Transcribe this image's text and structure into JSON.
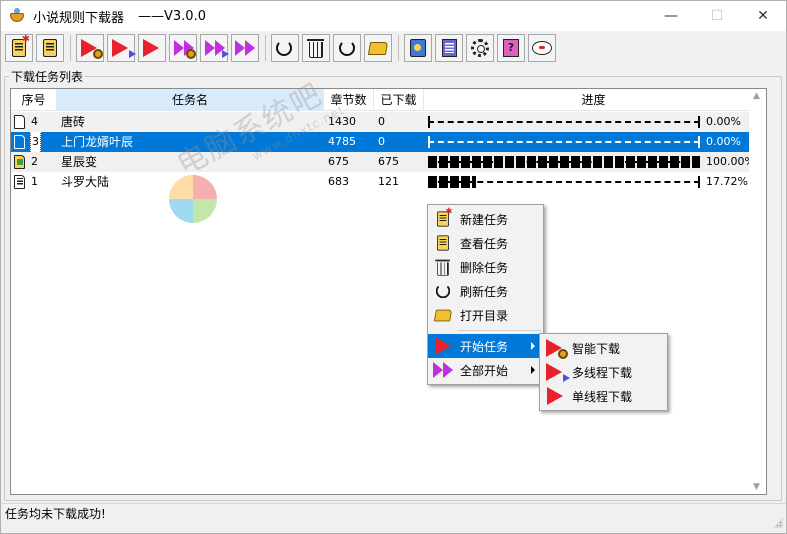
{
  "window": {
    "title": "小说规则下载器",
    "version": "——V3.0.0",
    "icon": "bowl-icon",
    "controls": {
      "minimize": "—",
      "maximize": "☐",
      "close": "✕"
    }
  },
  "toolbar": {
    "buttons": [
      {
        "name": "new-task",
        "icon": "new-document-icon"
      },
      {
        "name": "view-task",
        "icon": "document-lines-icon"
      },
      {
        "name": "smart-download",
        "icon": "play-gear-icon"
      },
      {
        "name": "multi-thread-download",
        "icon": "play-multi-icon"
      },
      {
        "name": "single-thread-download",
        "icon": "play-icon"
      },
      {
        "name": "start-all-smart",
        "icon": "fast-forward-gear-icon"
      },
      {
        "name": "start-all-multi",
        "icon": "fast-forward-multi-icon"
      },
      {
        "name": "start-all",
        "icon": "fast-forward-icon"
      },
      {
        "name": "stop",
        "icon": "stop-refresh-icon"
      },
      {
        "name": "delete-task",
        "icon": "trash-icon"
      },
      {
        "name": "refresh-task",
        "icon": "refresh-icon"
      },
      {
        "name": "open-directory",
        "icon": "folder-icon"
      },
      {
        "name": "rules",
        "icon": "rule-book-icon"
      },
      {
        "name": "log",
        "icon": "notepad-icon"
      },
      {
        "name": "settings",
        "icon": "gear-icon"
      },
      {
        "name": "help",
        "icon": "help-icon"
      },
      {
        "name": "feedback",
        "icon": "chat-icon"
      }
    ]
  },
  "task_list": {
    "group_label": "下载任务列表",
    "columns": [
      "序号",
      "任务名",
      "章节数",
      "已下载",
      "进度"
    ],
    "rows": [
      {
        "index": "4",
        "name": "唐砖",
        "chapters": "1430",
        "downloaded": "0",
        "progress": 0.0,
        "percent": "0.00%",
        "icon": "document-icon",
        "selected": false
      },
      {
        "index": "3",
        "name": "上门龙婿叶辰",
        "chapters": "4785",
        "downloaded": "0",
        "progress": 0.0,
        "percent": "0.00%",
        "icon": "document-icon",
        "selected": true
      },
      {
        "index": "2",
        "name": "星辰变",
        "chapters": "675",
        "downloaded": "675",
        "progress": 1.0,
        "percent": "100.00%",
        "icon": "completed-document-icon",
        "selected": false
      },
      {
        "index": "1",
        "name": "斗罗大陆",
        "chapters": "683",
        "downloaded": "121",
        "progress": 0.1772,
        "percent": "17.72%",
        "icon": "document-lines-icon",
        "selected": false
      }
    ]
  },
  "context_menu": {
    "items": [
      {
        "label": "新建任务",
        "icon": "new-document-icon"
      },
      {
        "label": "查看任务",
        "icon": "document-lines-icon"
      },
      {
        "label": "删除任务",
        "icon": "trash-icon"
      },
      {
        "label": "刷新任务",
        "icon": "refresh-icon"
      },
      {
        "label": "打开目录",
        "icon": "folder-icon"
      },
      {
        "label": "开始任务",
        "icon": "play-icon",
        "submenu": true,
        "highlighted": true
      },
      {
        "label": "全部开始",
        "icon": "fast-forward-icon",
        "submenu": true
      }
    ]
  },
  "submenu": {
    "items": [
      {
        "label": "智能下载",
        "icon": "play-gear-icon"
      },
      {
        "label": "多线程下载",
        "icon": "play-multi-icon"
      },
      {
        "label": "单线程下载",
        "icon": "play-icon"
      }
    ]
  },
  "status": {
    "text": "任务均未下载成功!"
  },
  "watermark": {
    "text": "电脑系统吧",
    "sub": "www.dnxtc.net"
  },
  "colors": {
    "selection": "#0078d7",
    "play": "#e8212d",
    "fast_forward": "#c030e0"
  }
}
